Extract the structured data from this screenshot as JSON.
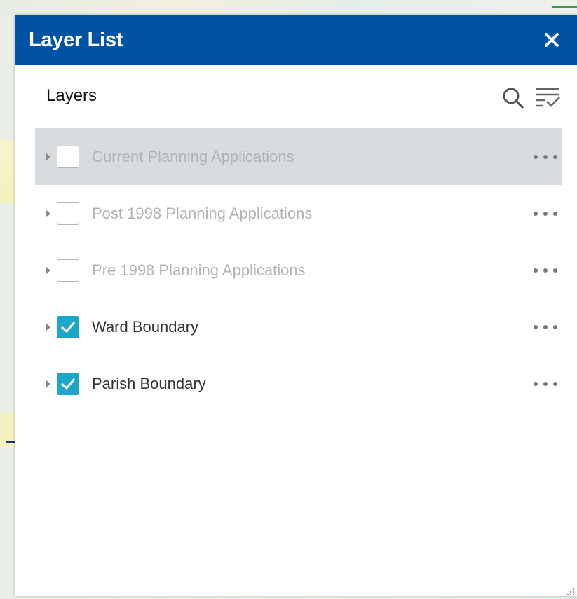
{
  "panel": {
    "title": "Layer List",
    "close_label": "×"
  },
  "layers_section": {
    "heading": "Layers",
    "search_icon": "search-icon",
    "filter_icon": "filter-list-icon"
  },
  "layers": [
    {
      "label": "Current Planning Applications",
      "checked": false,
      "visible_in_scale": false,
      "highlighted": true
    },
    {
      "label": "Post 1998 Planning Applications",
      "checked": false,
      "visible_in_scale": false,
      "highlighted": false
    },
    {
      "label": "Pre 1998 Planning Applications",
      "checked": false,
      "visible_in_scale": false,
      "highlighted": false
    },
    {
      "label": "Ward Boundary",
      "checked": true,
      "visible_in_scale": true,
      "highlighted": false
    },
    {
      "label": "Parish Boundary",
      "checked": true,
      "visible_in_scale": true,
      "highlighted": false
    }
  ],
  "colors": {
    "header_bg": "#0052a5",
    "checkbox_checked": "#1ea6c8",
    "highlight_row": "#d9dcdf"
  }
}
